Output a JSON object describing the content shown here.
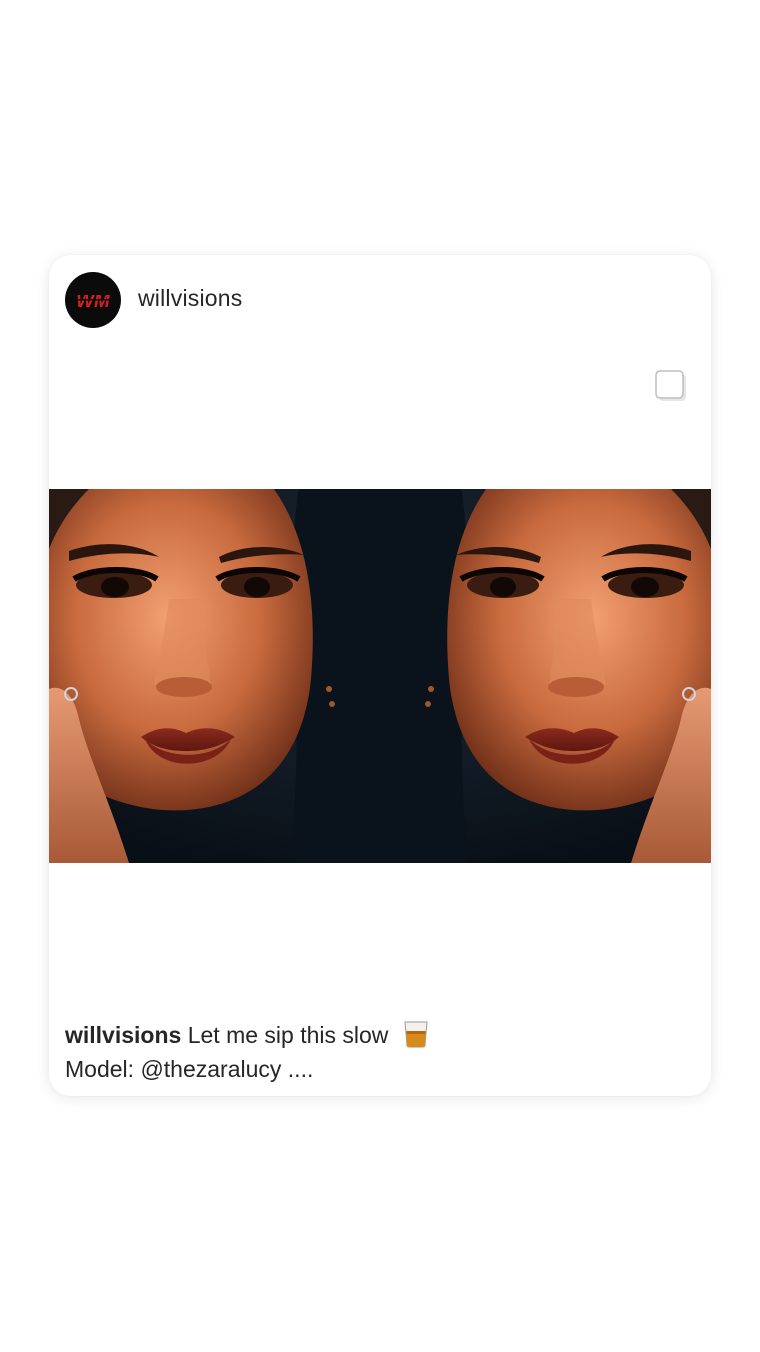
{
  "post": {
    "username": "willvisions",
    "avatar_text": "WM",
    "avatar_colors": {
      "background": "#0b0b0b",
      "logo": "#d42020"
    },
    "header_icon": "multiple-photos-icon",
    "photo_description_icon": "mirrored-portrait-photo",
    "caption": {
      "username": "willvisions",
      "text": "Let me sip this slow",
      "emoji_icon": "tumbler-glass-icon",
      "line2_prefix": "Model: ",
      "mention": "@thezaralucy",
      "line2_suffix": " ...."
    }
  }
}
